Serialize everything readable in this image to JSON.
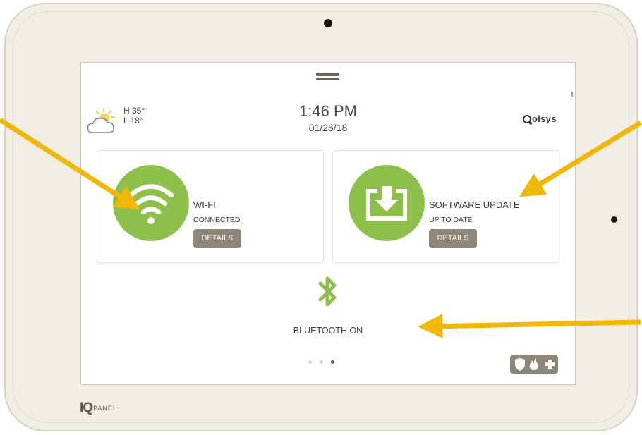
{
  "weather": {
    "high": "H 35°",
    "low": "L 18°",
    "icon": "cloud-sun-icon"
  },
  "clock": {
    "time": "1:46 PM",
    "date": "01/26/18"
  },
  "brand": {
    "name": "olsys"
  },
  "wifi_card": {
    "title": "WI-FI",
    "status": "CONNECTED",
    "button": "DETAILS",
    "icon": "wifi-icon",
    "color": "#8cc04b"
  },
  "update_card": {
    "title": "SOFTWARE UPDATE",
    "status": "UP TO DATE",
    "button": "DETAILS",
    "icon": "download-tray-icon",
    "color": "#8cc04b"
  },
  "bluetooth": {
    "label": "BLUETOOTH ON",
    "icon": "bluetooth-icon",
    "color": "#8cc04b"
  },
  "pager": {
    "total": 3,
    "active": 3
  },
  "status_button": {
    "icons": [
      "shield-icon",
      "fire-icon",
      "medical-cross-icon"
    ],
    "color": "#8f8677"
  },
  "device_logo": {
    "mark": "IQ",
    "text": "PANEL"
  },
  "annotations": {
    "arrow_color": "#f2b705"
  }
}
